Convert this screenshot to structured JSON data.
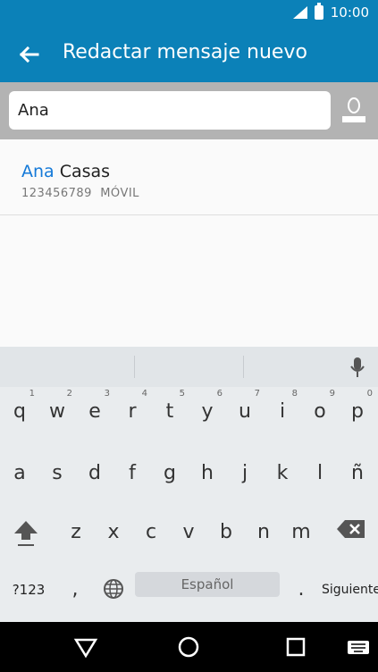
{
  "status": {
    "time": "10:00"
  },
  "header": {
    "title": "Redactar mensaje nuevo"
  },
  "recipient": {
    "value": "Ana"
  },
  "suggestion": {
    "match": "Ana",
    "rest": " Casas",
    "number": "123456789",
    "type": "MÓVIL"
  },
  "keyboard": {
    "rows": [
      [
        {
          "k": "q",
          "s": "1"
        },
        {
          "k": "w",
          "s": "2"
        },
        {
          "k": "e",
          "s": "3"
        },
        {
          "k": "r",
          "s": "4"
        },
        {
          "k": "t",
          "s": "5"
        },
        {
          "k": "y",
          "s": "6"
        },
        {
          "k": "u",
          "s": "7"
        },
        {
          "k": "i",
          "s": "8"
        },
        {
          "k": "o",
          "s": "9"
        },
        {
          "k": "p",
          "s": "0"
        }
      ],
      [
        "a",
        "s",
        "d",
        "f",
        "g",
        "h",
        "j",
        "k",
        "l",
        "ñ"
      ],
      [
        "z",
        "x",
        "c",
        "v",
        "b",
        "n",
        "m"
      ]
    ],
    "numbers_key": "?123",
    "comma_key": ",",
    "space_label": "Español",
    "period_key": ".",
    "next_key": "Siguiente"
  },
  "colors": {
    "accent": "#0b81b8",
    "match": "#1479d8"
  }
}
